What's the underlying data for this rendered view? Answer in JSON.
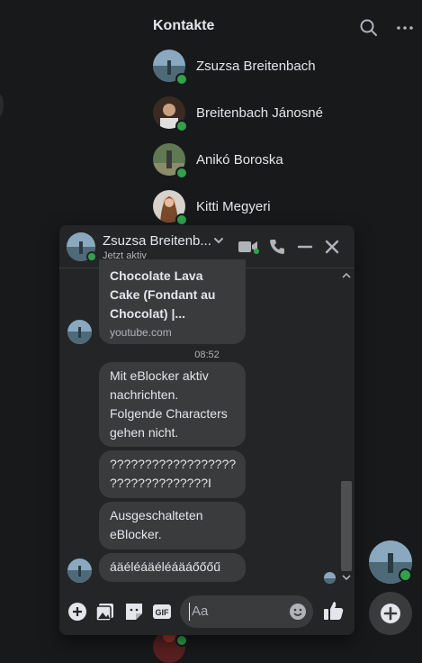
{
  "sidebar": {
    "title": "Kontakte",
    "contacts": [
      {
        "name": "Zsuzsa Breitenbach",
        "online": true
      },
      {
        "name": "Breitenbach Jánosné",
        "online": true
      },
      {
        "name": "Anikó Boroska",
        "online": true
      },
      {
        "name": "Kitti Megyeri",
        "online": true
      }
    ]
  },
  "chat": {
    "contact_name": "Zsuzsa Breitenb...",
    "status": "Jetzt aktiv",
    "link_preview": {
      "title_lines": [
        "Chocolate Lava",
        "Cake (Fondant au",
        "Chocolat) |..."
      ],
      "domain": "youtube.com"
    },
    "timestamp": "08:52",
    "messages": [
      {
        "lines": [
          "Mit eBlocker aktiv",
          "nachrichten.",
          "Folgende Characters",
          "gehen nicht."
        ]
      },
      {
        "lines": [
          "??????????????????",
          "??????????????‍I"
        ]
      },
      {
        "lines": [
          "Ausgeschalteten",
          "eBlocker."
        ]
      },
      {
        "lines": [
          "áäéléáäéléáäáőőőű"
        ]
      }
    ],
    "input_placeholder": "Aa"
  },
  "colors": {
    "background": "#18191a",
    "panel": "#242526",
    "bubble": "#3a3b3c",
    "accent_blue": "#2d88ff",
    "online_green": "#31a24c"
  },
  "icons": [
    "search-icon",
    "more-icon",
    "chevron-down-icon",
    "video-call-icon",
    "phone-icon",
    "minimize-icon",
    "close-icon",
    "add-icon",
    "image-icon",
    "sticker-icon",
    "gif-icon",
    "emoji-icon",
    "like-icon",
    "new-message-icon"
  ]
}
